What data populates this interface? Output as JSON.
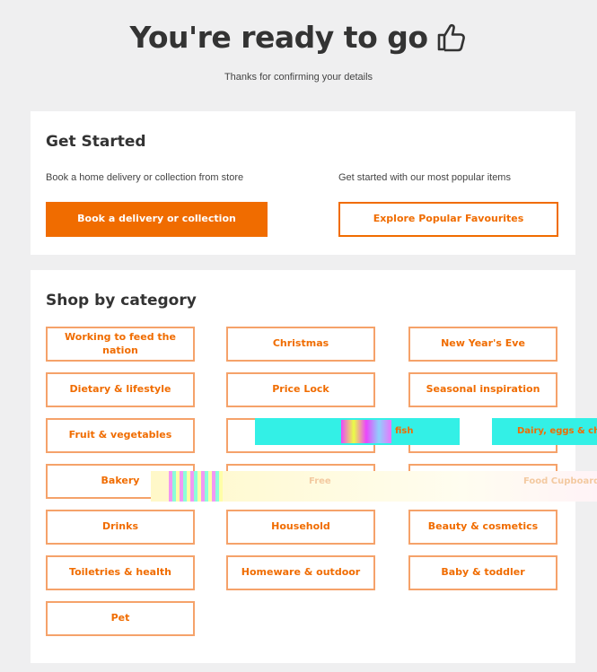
{
  "header": {
    "title": "You're ready to go",
    "subtitle": "Thanks for confirming your details",
    "thumb_icon": "thumbs-up-icon"
  },
  "get_started": {
    "heading": "Get Started",
    "delivery_desc": "Book a home delivery or collection from store",
    "popular_desc": "Get started with our most popular items",
    "book_button": "Book a delivery or collection",
    "explore_button": "Explore Popular Favourites"
  },
  "shop_by_category": {
    "heading": "Shop by category",
    "categories": [
      "Working to feed the nation",
      "Christmas",
      "New Year's Eve",
      "Dietary & lifestyle",
      "Price Lock",
      "Seasonal inspiration",
      "Fruit & vegetables",
      "",
      "",
      "Bakery",
      "",
      "",
      "Drinks",
      "Household",
      "Beauty & cosmetics",
      "Toiletries & health",
      "Homeware & outdoor",
      "Baby & toddler",
      "Pet"
    ],
    "overlay_labels": {
      "fish": "fish",
      "dairy": "Dairy, eggs & ch",
      "free": "Free",
      "food_cupboard": "Food Cupboard"
    }
  },
  "colors": {
    "accent": "#f06c00",
    "page_background": "#efeff0",
    "card_background": "#ffffff"
  }
}
